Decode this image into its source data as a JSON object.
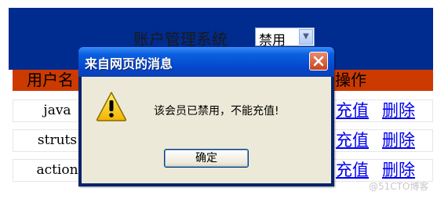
{
  "page": {
    "system_title": "账户管理系统",
    "status_filter": {
      "selected": "禁用"
    },
    "table": {
      "headers": [
        "用户名",
        "操作"
      ],
      "rows": [
        {
          "name": "java",
          "actions": [
            "充值",
            "删除"
          ]
        },
        {
          "name": "struts",
          "actions": [
            "充值",
            "删除"
          ]
        },
        {
          "name": "action",
          "actions": [
            "充值",
            "删除"
          ]
        }
      ]
    }
  },
  "dialog": {
    "title": "来自网页的消息",
    "message": "该会员已禁用，不能充值!",
    "ok_label": "确定",
    "icon": "warning-icon"
  },
  "watermark": "@51CTO博客",
  "colors": {
    "header_band": "#002b8f",
    "table_header": "#cc3a00",
    "link": "#0000ee",
    "dialog_body": "#ece9d8"
  }
}
